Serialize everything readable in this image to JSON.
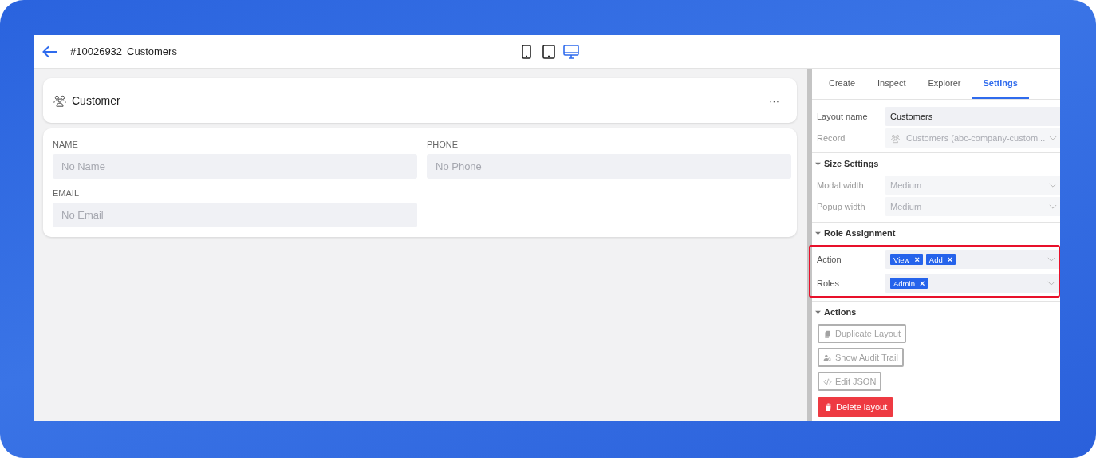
{
  "header": {
    "title": "#10026932",
    "subtitle": "Customers",
    "devices": [
      {
        "kind": "phone",
        "selected": false
      },
      {
        "kind": "tablet",
        "selected": false
      },
      {
        "kind": "desktop",
        "selected": true
      }
    ]
  },
  "card": {
    "title": "Customer",
    "menu": "···"
  },
  "form": {
    "fields": [
      {
        "label": "NAME",
        "placeholder": "No Name"
      },
      {
        "label": "PHONE",
        "placeholder": "No Phone"
      },
      {
        "label": "EMAIL",
        "placeholder": "No Email"
      }
    ]
  },
  "panel": {
    "tabs": [
      {
        "label": "Create",
        "selected": false
      },
      {
        "label": "Inspect",
        "selected": false
      },
      {
        "label": "Explorer",
        "selected": false
      },
      {
        "label": "Settings",
        "selected": true
      }
    ],
    "rows": [
      {
        "kind": "text",
        "label": "Layout name",
        "value": "Customers",
        "disabled": false
      },
      {
        "kind": "select",
        "label": "Record",
        "value": "Customers (abc-company-custom...",
        "disabled": true
      }
    ],
    "sections": [
      {
        "title": "Size Settings",
        "expanded": true,
        "rows": [
          {
            "kind": "select",
            "label": "Modal width",
            "value": "Medium",
            "disabled": true
          },
          {
            "kind": "select",
            "label": "Popup width",
            "value": "Medium",
            "disabled": true
          }
        ]
      },
      {
        "title": "Role Assignment",
        "expanded": true,
        "highlighted": true,
        "rows": [
          {
            "kind": "tags",
            "label": "Action",
            "tags": [
              {
                "label": "View",
                "remove": "×"
              },
              {
                "label": "Add",
                "remove": "×"
              }
            ],
            "disabled": false
          },
          {
            "kind": "tags",
            "label": "Roles",
            "tags": [
              {
                "label": "Admin",
                "remove": "×"
              }
            ],
            "disabled": false
          }
        ]
      },
      {
        "title": "Actions",
        "expanded": true,
        "buttons": [
          {
            "kind": "outline",
            "label": "Duplicate Layout"
          },
          {
            "kind": "outline",
            "label": "Show Audit Trail"
          },
          {
            "kind": "outline",
            "label": "Edit JSON"
          },
          {
            "kind": "danger",
            "label": "Delete layout"
          }
        ]
      }
    ]
  }
}
